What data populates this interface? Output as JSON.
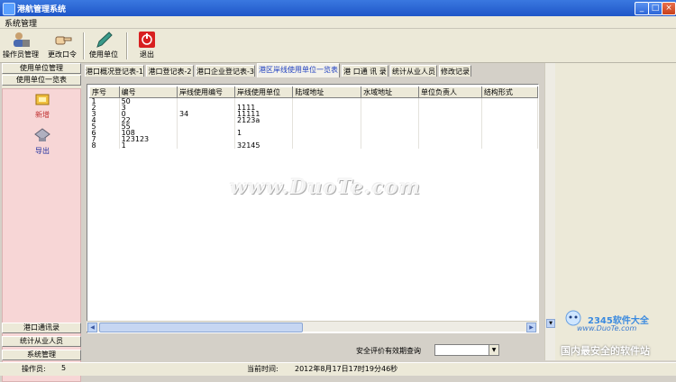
{
  "window": {
    "title": "港航管理系统"
  },
  "menu": {
    "item": "系统管理"
  },
  "toolbar": {
    "operator_manage": "操作员管理",
    "change_password": "更改口令",
    "user_unit": "使用单位",
    "exit": "退出"
  },
  "sidebar": {
    "top_items": [
      "使用单位管理",
      "使用单位一览表"
    ],
    "pink_items": [
      "新增",
      "导出"
    ],
    "bottom_items": [
      "港口通讯录",
      "统计从业人员",
      "系统管理"
    ]
  },
  "tabs": [
    "港口概况登记表-1",
    "港口登记表-2",
    "港口企业登记表-3",
    "港区岸线使用单位一览表",
    "港 口通 讯 录",
    "统计从业人员",
    "修改记录"
  ],
  "grid": {
    "columns": [
      "序号",
      "编号",
      "岸线使用编号",
      "岸线使用单位",
      "陆域地址",
      "水域地址",
      "单位负责人",
      "结构形式"
    ],
    "rows": [
      [
        "1",
        "50",
        "",
        "",
        "",
        "",
        "",
        ""
      ],
      [
        "2",
        "3",
        "",
        "1111",
        "",
        "",
        "",
        ""
      ],
      [
        "3",
        "0",
        "34",
        "11111",
        "",
        "",
        "",
        ""
      ],
      [
        "4",
        "22",
        "",
        "2123a",
        "",
        "",
        "",
        ""
      ],
      [
        "5",
        "55",
        "",
        "",
        "",
        "",
        "",
        ""
      ],
      [
        "6",
        "108",
        "",
        "1",
        "",
        "",
        "",
        ""
      ],
      [
        "7",
        "123123",
        "",
        "",
        "",
        "",
        "",
        ""
      ],
      [
        "8",
        "1",
        "",
        "32145",
        "",
        "",
        "",
        ""
      ]
    ]
  },
  "filter": {
    "label": "安全评价有效期查询"
  },
  "status": {
    "operator_label": "操作员:",
    "operator_value": "5",
    "time_label": "当前时间:",
    "time_value": "2012年8月17日17时19分46秒"
  },
  "watermarks": {
    "main": "www.DuoTe.com",
    "site": "www.DuoTe.com",
    "brand": "2345软件大全",
    "slogan": "国内最安全的软件站"
  },
  "colors": {
    "titlebar": "#2a5fd0",
    "pink_panel": "#f7d6d6",
    "active_tab_text": "#2040c0"
  }
}
